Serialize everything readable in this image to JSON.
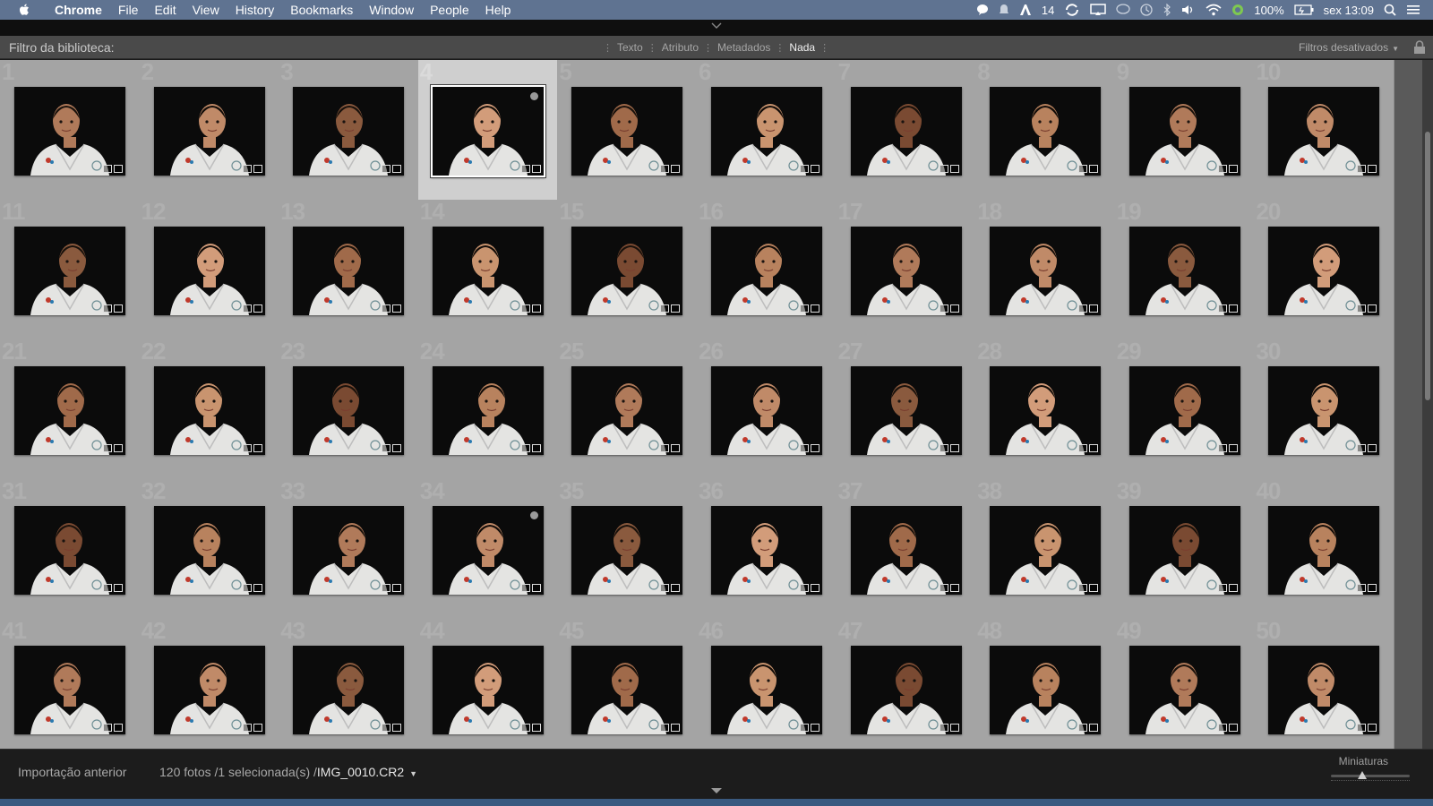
{
  "menubar": {
    "apple_icon": "apple-logo-icon",
    "items": [
      "Chrome",
      "File",
      "Edit",
      "View",
      "History",
      "Bookmarks",
      "Window",
      "People",
      "Help"
    ],
    "status": {
      "adobe_count": "14",
      "battery": "100%",
      "clock": "sex 13:09"
    }
  },
  "filterbar": {
    "label": "Filtro da biblioteca:",
    "tabs": [
      "Texto",
      "Atributo",
      "Metadados",
      "Nada"
    ],
    "active_tab": "Nada",
    "filters_label": "Filtros desativados"
  },
  "grid": {
    "columns": 10,
    "selected_index": 4,
    "flagged_indices": [
      4,
      34
    ],
    "cells": [
      {
        "n": "1"
      },
      {
        "n": "2"
      },
      {
        "n": "3"
      },
      {
        "n": "4"
      },
      {
        "n": "5"
      },
      {
        "n": "6"
      },
      {
        "n": "7"
      },
      {
        "n": "8"
      },
      {
        "n": "9"
      },
      {
        "n": "10"
      },
      {
        "n": "11"
      },
      {
        "n": "12"
      },
      {
        "n": "13"
      },
      {
        "n": "14"
      },
      {
        "n": "15"
      },
      {
        "n": "16"
      },
      {
        "n": "17"
      },
      {
        "n": "18"
      },
      {
        "n": "19"
      },
      {
        "n": "20"
      },
      {
        "n": "21"
      },
      {
        "n": "22"
      },
      {
        "n": "23"
      },
      {
        "n": "24"
      },
      {
        "n": "25"
      },
      {
        "n": "26"
      },
      {
        "n": "27"
      },
      {
        "n": "28"
      },
      {
        "n": "29"
      },
      {
        "n": "30"
      },
      {
        "n": "31"
      },
      {
        "n": "32"
      },
      {
        "n": "33"
      },
      {
        "n": "34"
      },
      {
        "n": "35"
      },
      {
        "n": "36"
      },
      {
        "n": "37"
      },
      {
        "n": "38"
      },
      {
        "n": "39"
      },
      {
        "n": "40"
      },
      {
        "n": "41"
      },
      {
        "n": "42"
      },
      {
        "n": "43"
      },
      {
        "n": "44"
      },
      {
        "n": "45"
      },
      {
        "n": "46"
      },
      {
        "n": "47"
      },
      {
        "n": "48"
      },
      {
        "n": "49"
      },
      {
        "n": "50"
      }
    ]
  },
  "bottombar": {
    "source": "Importação anterior",
    "count": "120 fotos /1 selecionada(s) /",
    "filename": "IMG_0010.CR2",
    "thumb_label": "Miniaturas"
  },
  "colors": {
    "menubar": "#5f7391",
    "cell_bg": "#a4a4a4",
    "cell_selected_bg": "#cfcfcf",
    "panel_dark": "#1c1c1c"
  }
}
